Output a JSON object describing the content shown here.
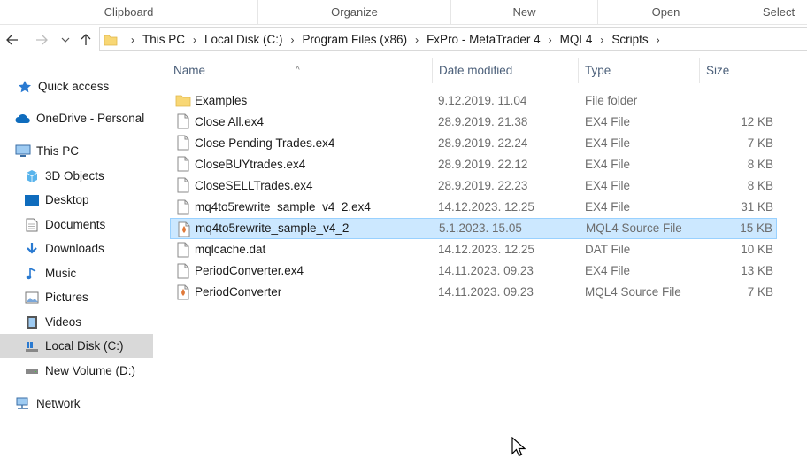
{
  "ribbon": {
    "groups": [
      "Clipboard",
      "Organize",
      "New",
      "Open",
      "Select"
    ]
  },
  "address": {
    "crumbs": [
      "This PC",
      "Local Disk (C:)",
      "Program Files (x86)",
      "FxPro - MetaTrader 4",
      "MQL4",
      "Scripts"
    ]
  },
  "sidebar": {
    "items": [
      {
        "label": "Quick access",
        "icon": "star-icon"
      },
      {
        "label": "OneDrive - Personal",
        "icon": "cloud-icon"
      },
      {
        "label": "This PC",
        "icon": "computer-icon"
      },
      {
        "label": "3D Objects",
        "icon": "cube-icon"
      },
      {
        "label": "Desktop",
        "icon": "desktop-icon"
      },
      {
        "label": "Documents",
        "icon": "document-icon"
      },
      {
        "label": "Downloads",
        "icon": "download-icon"
      },
      {
        "label": "Music",
        "icon": "music-icon"
      },
      {
        "label": "Pictures",
        "icon": "picture-icon"
      },
      {
        "label": "Videos",
        "icon": "video-icon"
      },
      {
        "label": "Local Disk (C:)",
        "icon": "drive-icon"
      },
      {
        "label": "New Volume (D:)",
        "icon": "drive-icon"
      },
      {
        "label": "Network",
        "icon": "network-icon"
      }
    ]
  },
  "columns": {
    "name": "Name",
    "date": "Date modified",
    "type": "Type",
    "size": "Size"
  },
  "files": [
    {
      "name": "Examples",
      "date": "9.12.2019. 11.04",
      "type": "File folder",
      "size": "",
      "icon": "folder-icon"
    },
    {
      "name": "Close All.ex4",
      "date": "28.9.2019. 21.38",
      "type": "EX4 File",
      "size": "12 KB",
      "icon": "file-icon"
    },
    {
      "name": "Close Pending Trades.ex4",
      "date": "28.9.2019. 22.24",
      "type": "EX4 File",
      "size": "7 KB",
      "icon": "file-icon"
    },
    {
      "name": "CloseBUYtrades.ex4",
      "date": "28.9.2019. 22.12",
      "type": "EX4 File",
      "size": "8 KB",
      "icon": "file-icon"
    },
    {
      "name": "CloseSELLTrades.ex4",
      "date": "28.9.2019. 22.23",
      "type": "EX4 File",
      "size": "8 KB",
      "icon": "file-icon"
    },
    {
      "name": "mq4to5rewrite_sample_v4_2.ex4",
      "date": "14.12.2023. 12.25",
      "type": "EX4 File",
      "size": "31 KB",
      "icon": "file-icon"
    },
    {
      "name": "mq4to5rewrite_sample_v4_2",
      "date": "5.1.2023. 15.05",
      "type": "MQL4 Source File",
      "size": "15 KB",
      "icon": "mql4-source-icon"
    },
    {
      "name": "mqlcache.dat",
      "date": "14.12.2023. 12.25",
      "type": "DAT File",
      "size": "10 KB",
      "icon": "file-icon"
    },
    {
      "name": "PeriodConverter.ex4",
      "date": "14.11.2023. 09.23",
      "type": "EX4 File",
      "size": "13 KB",
      "icon": "file-icon"
    },
    {
      "name": "PeriodConverter",
      "date": "14.11.2023. 09.23",
      "type": "MQL4 Source File",
      "size": "7 KB",
      "icon": "mql4-source-icon"
    }
  ],
  "colors": {
    "selection_bg": "#cce8ff",
    "selection_border": "#99d1ff",
    "sidebar_selected": "#d9d9d9",
    "folder_yellow": "#f8d775"
  }
}
